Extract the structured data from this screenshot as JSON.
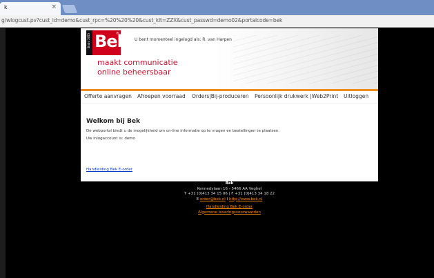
{
  "browser": {
    "tab_title": "k",
    "tab_close": "×",
    "url": "g/wlogcust.pv?cust_id=demo&cust_rpc=%20%20%20&cust_klt=ZZX&cust_passwd=demo02&portalcode=bek"
  },
  "header": {
    "logo_text": "Bek",
    "logo_reg": "®",
    "logo_side": "Sinds 1955",
    "login_message": "U bent momenteel ingelogd als: R. van Harpen",
    "tagline_1": "maakt communicatie",
    "tagline_2": "online beheersbaar"
  },
  "nav": {
    "items": [
      "Offerte aanvragen",
      "Afroepen voorraad",
      "Orders|Bij-produceren",
      "Persoonlijk drukwerk |Web2Print",
      "Uitloggen"
    ]
  },
  "content": {
    "welcome": "Welkom bij Bek",
    "intro": "De webportal biedt u de mogelijkheid om on-line informatie op te vragen en bestellingen te plaatsen.",
    "account": "Uw inlogaccount is: demo",
    "manual_link": "Handleiding Bek E-order"
  },
  "footer": {
    "company": "Bek",
    "address": "Kennedylaan 16 - 5466 AA Veghel",
    "phone": "T +31 [0]413 34 15 06 | F +31 [0]413 34 18 22",
    "email_prefix": "E ",
    "email": "order@bek.nl",
    "web_prefix": " I ",
    "web": "http://www.bek.nl",
    "link_manual": "Handleiding Bek E-order",
    "link_terms": "Algemene leveringsvoorwaarden"
  },
  "colors": {
    "brand_red": "#d0011b",
    "accent_orange": "#f08c1e",
    "link_blue": "#0033cc",
    "footer_link": "#ff8a00"
  }
}
